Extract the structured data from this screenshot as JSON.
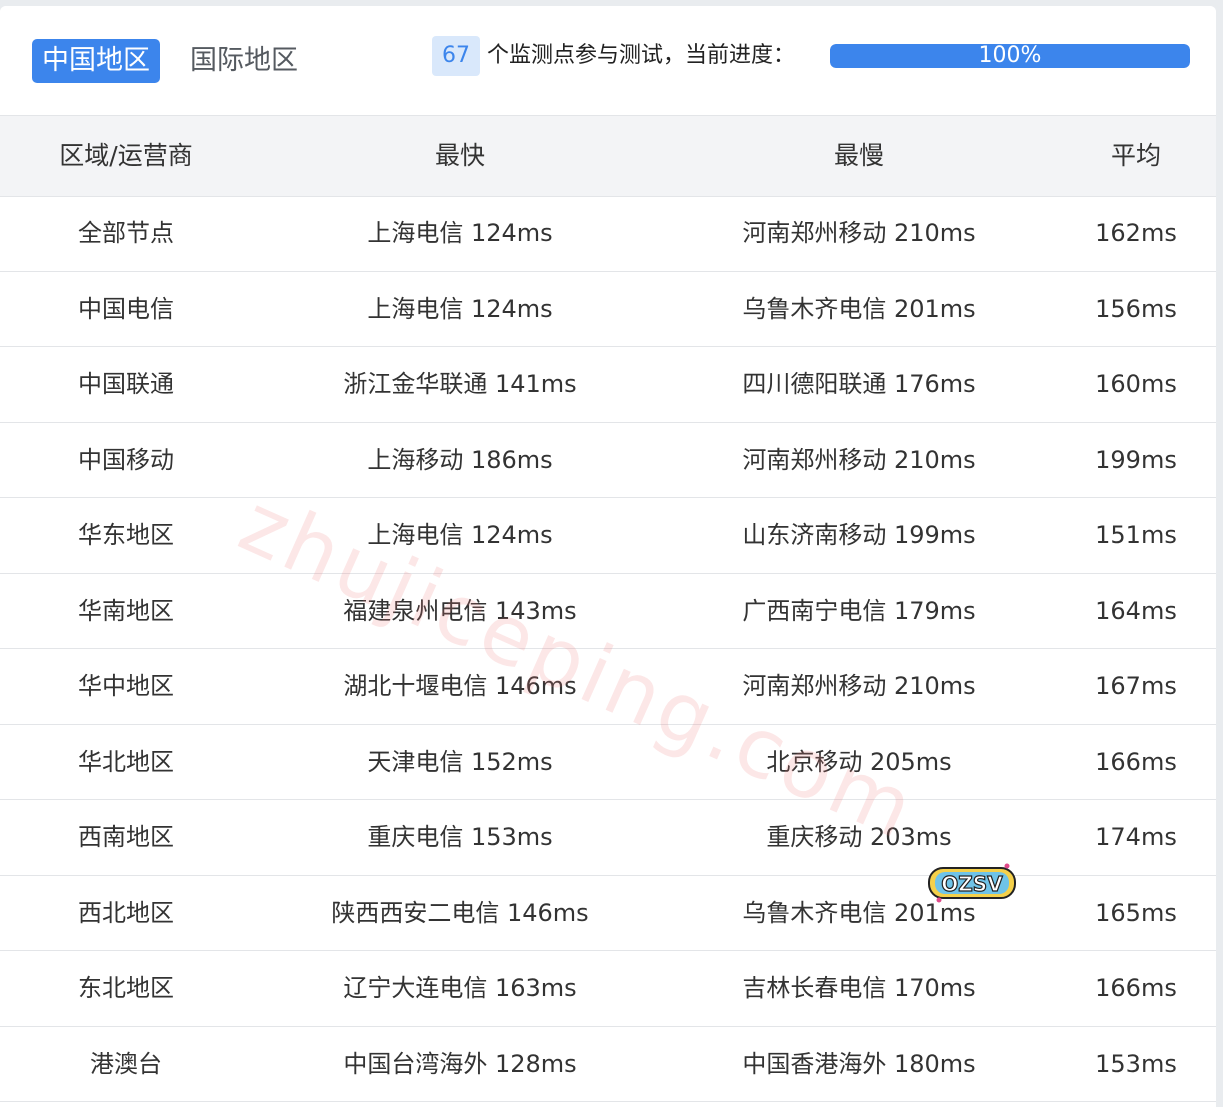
{
  "tabs": [
    {
      "label": "中国地区",
      "active": true
    },
    {
      "label": "国际地区",
      "active": false
    }
  ],
  "status": {
    "count": "67",
    "text": "个监测点参与测试，当前进度：",
    "progress_label": "100%",
    "progress": 1.0
  },
  "table": {
    "headers": [
      "区域/运营商",
      "最快",
      "最慢",
      "平均"
    ],
    "rows": [
      [
        "全部节点",
        "上海电信 124ms",
        "河南郑州移动 210ms",
        "162ms"
      ],
      [
        "中国电信",
        "上海电信 124ms",
        "乌鲁木齐电信 201ms",
        "156ms"
      ],
      [
        "中国联通",
        "浙江金华联通 141ms",
        "四川德阳联通 176ms",
        "160ms"
      ],
      [
        "中国移动",
        "上海移动 186ms",
        "河南郑州移动 210ms",
        "199ms"
      ],
      [
        "华东地区",
        "上海电信 124ms",
        "山东济南移动 199ms",
        "151ms"
      ],
      [
        "华南地区",
        "福建泉州电信 143ms",
        "广西南宁电信 179ms",
        "164ms"
      ],
      [
        "华中地区",
        "湖北十堰电信 146ms",
        "河南郑州移动 210ms",
        "167ms"
      ],
      [
        "华北地区",
        "天津电信 152ms",
        "北京移动 205ms",
        "166ms"
      ],
      [
        "西南地区",
        "重庆电信 153ms",
        "重庆移动 203ms",
        "174ms"
      ],
      [
        "西北地区",
        "陕西西安二电信 146ms",
        "乌鲁木齐电信 201ms",
        "165ms"
      ],
      [
        "东北地区",
        "辽宁大连电信 163ms",
        "吉林长春电信 170ms",
        "166ms"
      ],
      [
        "港澳台",
        "中国台湾海外 128ms",
        "中国香港海外 180ms",
        "153ms"
      ]
    ]
  },
  "watermark": "zhujiceping.com",
  "logo_text": "OZSV",
  "colors": {
    "accent": "#3c85ec",
    "badge_bg": "#d9e8fb",
    "header_bg": "#f3f4f6"
  }
}
